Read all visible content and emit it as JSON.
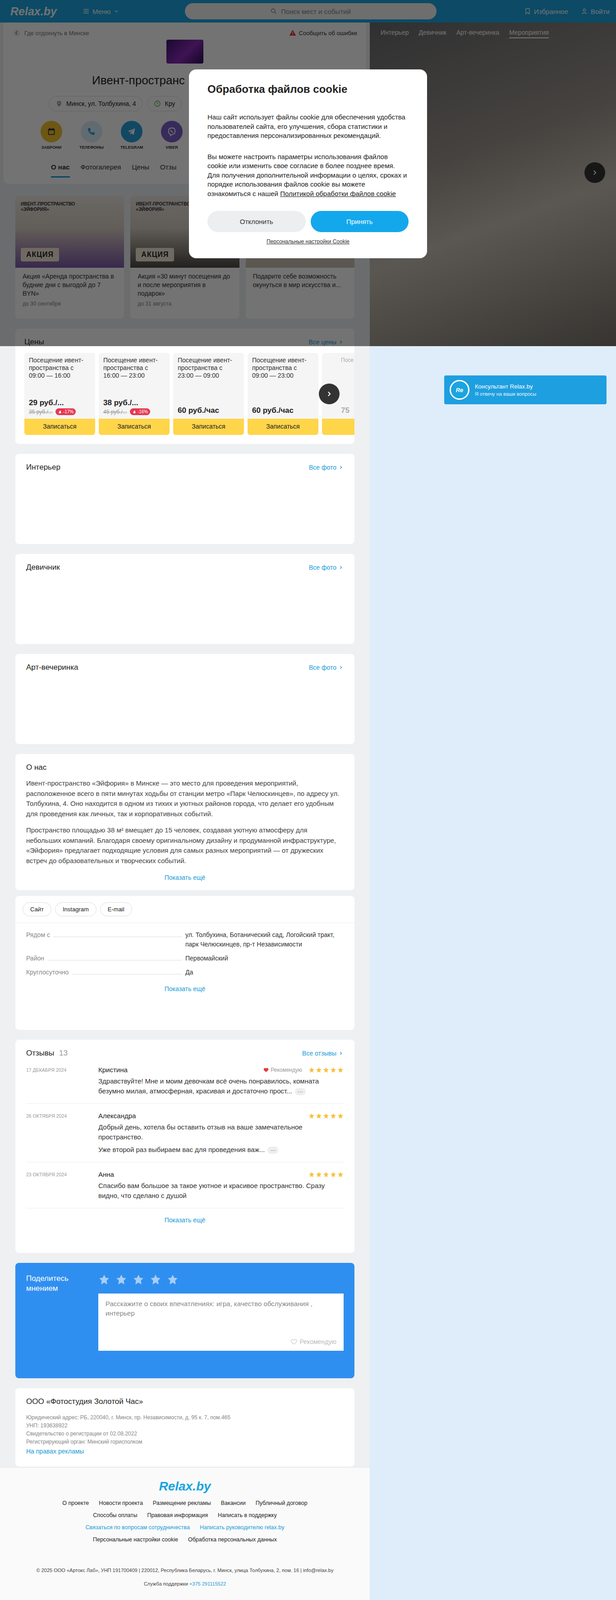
{
  "header": {
    "logo": "Relax.by",
    "menu": "Меню",
    "search_placeholder": "Поиск мест и событий",
    "favorites": "Избранное",
    "login": "Войти"
  },
  "breadcrumb": {
    "back": "Где отдохнуть в Минске",
    "report": "Сообщить об ошибке"
  },
  "place": {
    "title": "Ивент-пространс",
    "chips": [
      {
        "label": "Минск, ул. Толбухина, 4",
        "kind": "address"
      },
      {
        "label": "Кру",
        "kind": "hours"
      }
    ],
    "actions": [
      {
        "label": "ЗАБРОНИ",
        "kind": "booking",
        "color": "#f2c12e"
      },
      {
        "label": "ТЕЛЕФОНЫ",
        "kind": "phone",
        "color": "#d9eef9"
      },
      {
        "label": "TELEGRAM",
        "kind": "telegram",
        "color": "#2aa1da"
      },
      {
        "label": "VIBER",
        "kind": "viber",
        "color": "#7b5fc9"
      }
    ],
    "tabs": [
      {
        "label": "О нас",
        "selected": true
      },
      {
        "label": "Фотогалерея",
        "selected": false
      },
      {
        "label": "Цены",
        "selected": false
      },
      {
        "label": "Отзы",
        "selected": false
      }
    ]
  },
  "promos": [
    {
      "tag": "ИВЕНТ-ПРОСТРАНСТВО «ЭЙФОРИЯ»",
      "badge": "АКЦИЯ",
      "text": "Акция «Аренда пространства в будние дни с выгодой до 7 BYN»",
      "date": "до 30 сентября"
    },
    {
      "tag": "ИВЕНТ-ПРОСТРАНСТВО «ЭЙФОРИЯ»",
      "badge": "АКЦИЯ",
      "text": "Акция «30 минут посещения до и после мероприятия в подарок»",
      "date": "до 31 августа"
    },
    {
      "tag": "",
      "badge": "",
      "text": "Подарите себе возможность окунуться в мир искусства и...",
      "date": ""
    }
  ],
  "prices": {
    "title": "Цены",
    "all": "Все цены",
    "items": [
      {
        "kind": "full",
        "title": "Посещение ивент-пространства с 09:00 — 16:00",
        "price": "29 руб./...",
        "old_price": "35 руб./...",
        "discount": "-17%",
        "button": "Записаться"
      },
      {
        "kind": "full",
        "title": "Посещение ивент-пространства с 16:00 — 23:00",
        "price": "38 руб./...",
        "old_price": "45 руб./...",
        "discount": "-16%",
        "button": "Записаться"
      },
      {
        "kind": "full",
        "title": "Посещение ивент-пространства с 23:00 — 09:00",
        "price": "60 руб./час",
        "old_price": "",
        "discount": "",
        "button": "Записаться"
      },
      {
        "kind": "full",
        "title": "Посещение ивент-пространства с 09:00 — 23:00",
        "price": "60 руб./час",
        "old_price": "",
        "discount": "",
        "button": "Записаться"
      },
      {
        "kind": "peek",
        "title": "Посе",
        "price": "75",
        "old_price": "",
        "discount": "",
        "button": ""
      }
    ]
  },
  "galleries": [
    {
      "title": "Интерьер",
      "all": "Все фото"
    },
    {
      "title": "Девичник",
      "all": "Все фото"
    },
    {
      "title": "Арт-вечеринка",
      "all": "Все фото"
    }
  ],
  "about": {
    "title": "О нас",
    "paragraphs": [
      "Ивент-пространство «Эйфория» в Минске — это место для проведения мероприятий, расположенное всего в пяти минутах ходьбы от станции метро «Парк Челюскинцев», по адресу ул. Толбухина, 4. Оно находится в одном из тихих и уютных районов города, что делает его удобным для проведения как личных, так и корпоративных событий.",
      "Пространство площадью 38 м² вмещает до 15 человек, создавая уютную атмосферу для небольших компаний. Благодаря своему оригинальному дизайну и продуманной инфраструктуре, «Эйфория» предлагает подходящие условия для самых разных мероприятий — от дружеских встреч до образовательных и творческих событий."
    ],
    "more": "Показать ещё"
  },
  "links": [
    "Сайт",
    "Instagram",
    "E-mail"
  ],
  "details": {
    "rows": [
      {
        "label": "Рядом с",
        "value": "ул. Толбухина, Ботанический сад, Логойский тракт, парк Челюскинцев, пр-т Независимости"
      },
      {
        "label": "Район",
        "value": "Первомайский"
      },
      {
        "label": "Круглосуточно",
        "value": "Да"
      }
    ],
    "more": "Показать ещё"
  },
  "reviews": {
    "title": "Отзывы",
    "count": "13",
    "all": "Все отзывы",
    "more": "Показать ещё",
    "items": [
      {
        "date": "17 ДЕКАБРЯ 2024",
        "author": "Кристина",
        "recommend": "Рекомендую",
        "stars": 5,
        "lines": [
          "Здравствуйте! Мне и моим девочкам всё очень понравилось, комната безумно милая, атмосферная, красивая и достаточно прост..."
        ],
        "more": "···"
      },
      {
        "date": "26 ОКТЯБРЯ 2024",
        "author": "Александра",
        "recommend": "",
        "stars": 5,
        "lines": [
          "Добрый день, хотела бы оставить отзыв на ваше замечательное пространство.",
          "Уже второй раз выбираем вас для проведения важ..."
        ],
        "more": "···"
      },
      {
        "date": "23 ОКТЯБРЯ 2024",
        "author": "Анна",
        "recommend": "",
        "stars": 5,
        "lines": [
          "Спасибо вам большое за такое уютное и красивое пространство. Сразу видно, что сделано с душой"
        ],
        "more": ""
      }
    ]
  },
  "share": {
    "title": "Поделитесь мнением",
    "stars": 0,
    "placeholder": "Расскажите о своих впечатлениях: игра, качество обслуживания , интерьер",
    "recommend": "Рекомендую"
  },
  "company": {
    "name": "ООО «Фотостудия Золотой Час»",
    "lines": [
      "Юридический адрес: РБ, 220040, г. Минск, пр. Независимости, д. 95 к. 7, пом.465",
      "УНП: 193638922",
      "Свидетельство о регистрации от 02.08.2022",
      "Регистрирующий орган: Минский горисполком"
    ],
    "ad": "На правах рекламы"
  },
  "footer": {
    "logo": "Relax.by",
    "rows": [
      {
        "kind": "plain",
        "links": [
          "О проекте",
          "Новости проекта",
          "Размещение рекламы",
          "Вакансии",
          "Публичный договор"
        ]
      },
      {
        "kind": "plain",
        "links": [
          "Способы оплаты",
          "Правовая информация",
          "Написать в поддержку"
        ]
      },
      {
        "kind": "accent",
        "links": [
          "Связаться по вопросам сотрудничества",
          "Написать руководителю relax.by"
        ]
      },
      {
        "kind": "plain",
        "links": [
          "Персональные настройки cookie",
          "Обработка персональных данных"
        ]
      }
    ],
    "legal": "© 2025 ООО «Артокс Лаб», УНП 191700409 | 220012, Республика Беларусь, г. Минск, улица Толбухина, 2, пом. 16 | info@relax.by",
    "support": "Служба поддержки",
    "phone": "+375 291115522"
  },
  "gallery": {
    "tabs": [
      {
        "label": "Интерьер",
        "selected": false
      },
      {
        "label": "Девичник",
        "selected": false
      },
      {
        "label": "Арт-вечеринка",
        "selected": false
      },
      {
        "label": "Мероприятия",
        "selected": true
      }
    ]
  },
  "consultant": {
    "avatar": "Re",
    "title": "Консультант Relax.by",
    "subtitle": "Я отвечу на ваши вопросы"
  },
  "cookie": {
    "title": "Обработка файлов cookie",
    "p1": "Наш сайт использует файлы cookie для обеспечения удобства пользователей сайта, его улучшения, сбора статистики и предоставления персонализированных рекомендаций.",
    "p2": "Вы можете настроить параметры использования файлов cookie или изменить свое согласие в более позднее время. Для получения дополнительной информации о целях, сроках и порядке использования файлов cookie вы можете ознакомиться с нашей",
    "policy": "Политикой обработки файлов cookie",
    "decline": "Отклонить",
    "accept": "Принять",
    "settings": "Персональные настройки Cookie"
  }
}
